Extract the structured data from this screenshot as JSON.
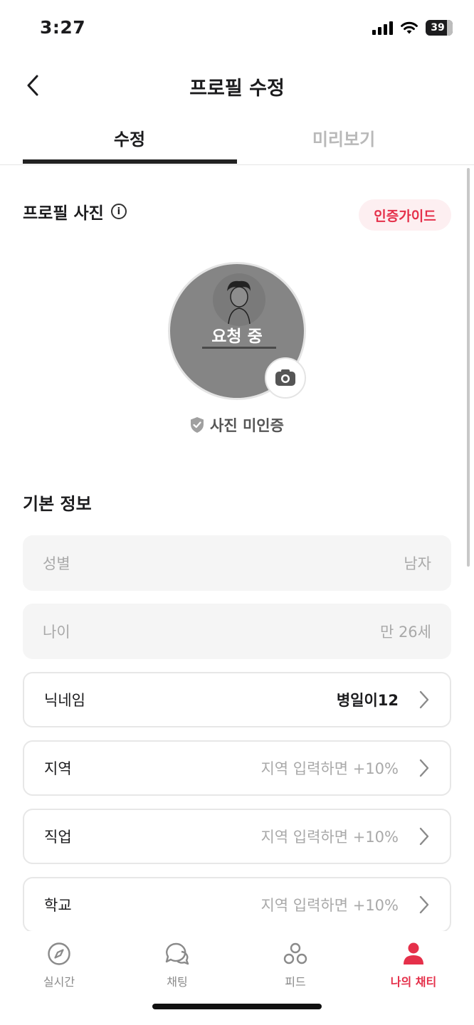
{
  "status_bar": {
    "time": "3:27",
    "battery": "39"
  },
  "header": {
    "title": "프로필 수정"
  },
  "tabs": [
    {
      "label": "수정",
      "active": true
    },
    {
      "label": "미리보기",
      "active": false
    }
  ],
  "profile_photo": {
    "title": "프로필 사진",
    "guide_button": "인증가이드",
    "avatar_status": "요청 중",
    "verification_status": "사진 미인증"
  },
  "basic_info": {
    "title": "기본 정보",
    "fields": [
      {
        "label": "성별",
        "value": "남자"
      },
      {
        "label": "나이",
        "value": "만 26세"
      },
      {
        "label": "닉네임",
        "value": "병일이12"
      },
      {
        "label": "지역",
        "value": "지역 입력하면 +10%"
      },
      {
        "label": "직업",
        "value": "지역 입력하면 +10%"
      },
      {
        "label": "학교",
        "value": "지역 입력하면 +10%"
      }
    ]
  },
  "bottom_nav": [
    {
      "label": "실시간",
      "icon": "compass-icon"
    },
    {
      "label": "채팅",
      "icon": "chat-bubbles-icon"
    },
    {
      "label": "피드",
      "icon": "feed-circles-icon"
    },
    {
      "label": "나의 채티",
      "icon": "person-icon",
      "active": true
    }
  ],
  "colors": {
    "accent": "#e5304a",
    "guide_bg": "#fdeff1",
    "disabled_field_bg": "#f5f5f5"
  }
}
